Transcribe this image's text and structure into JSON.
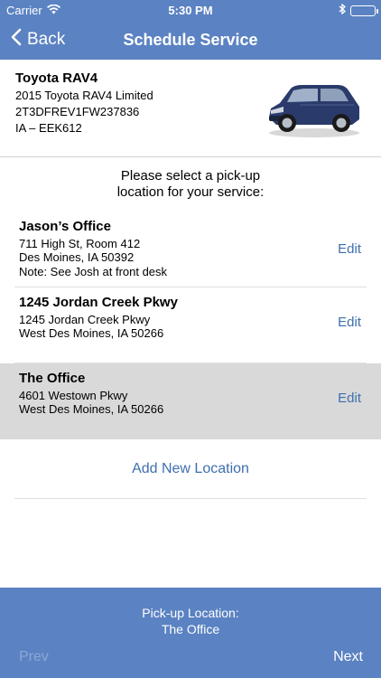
{
  "status_bar": {
    "carrier": "Carrier",
    "time": "5:30 PM",
    "battery_level": 1.0,
    "battery_color": "#4cd964"
  },
  "nav": {
    "back_label": "Back",
    "title": "Schedule Service",
    "back_icon": "chevron-left-icon"
  },
  "vehicle": {
    "name": "Toyota RAV4",
    "model": "2015 Toyota RAV4 Limited",
    "vin": "2T3DFREV1FW237836",
    "plate": "IA – EEK612",
    "image": "car-image"
  },
  "prompt": {
    "line1": "Please select a pick-up",
    "line2": "location for your service:"
  },
  "locations": [
    {
      "name": "Jason’s Office",
      "line1": "711 High St, Room 412",
      "line2": "Des Moines, IA 50392",
      "line3": "Note: See Josh at front desk",
      "edit_label": "Edit",
      "selected": false
    },
    {
      "name": "1245 Jordan Creek Pkwy",
      "line1": "1245 Jordan Creek Pkwy",
      "line2": "West Des Moines, IA 50266",
      "edit_label": "Edit",
      "selected": false
    },
    {
      "name": "The Office",
      "line1": "4601 Westown Pkwy",
      "line2": "West Des Moines, IA 50266",
      "edit_label": "Edit",
      "selected": true
    }
  ],
  "add_new_label": "Add New Location",
  "footer": {
    "label": "Pick-up Location:",
    "value": "The Office",
    "prev_label": "Prev",
    "next_label": "Next"
  },
  "colors": {
    "brand": "#5b82c2",
    "link": "#3e6fae",
    "selected_row": "#d9d9d9"
  }
}
